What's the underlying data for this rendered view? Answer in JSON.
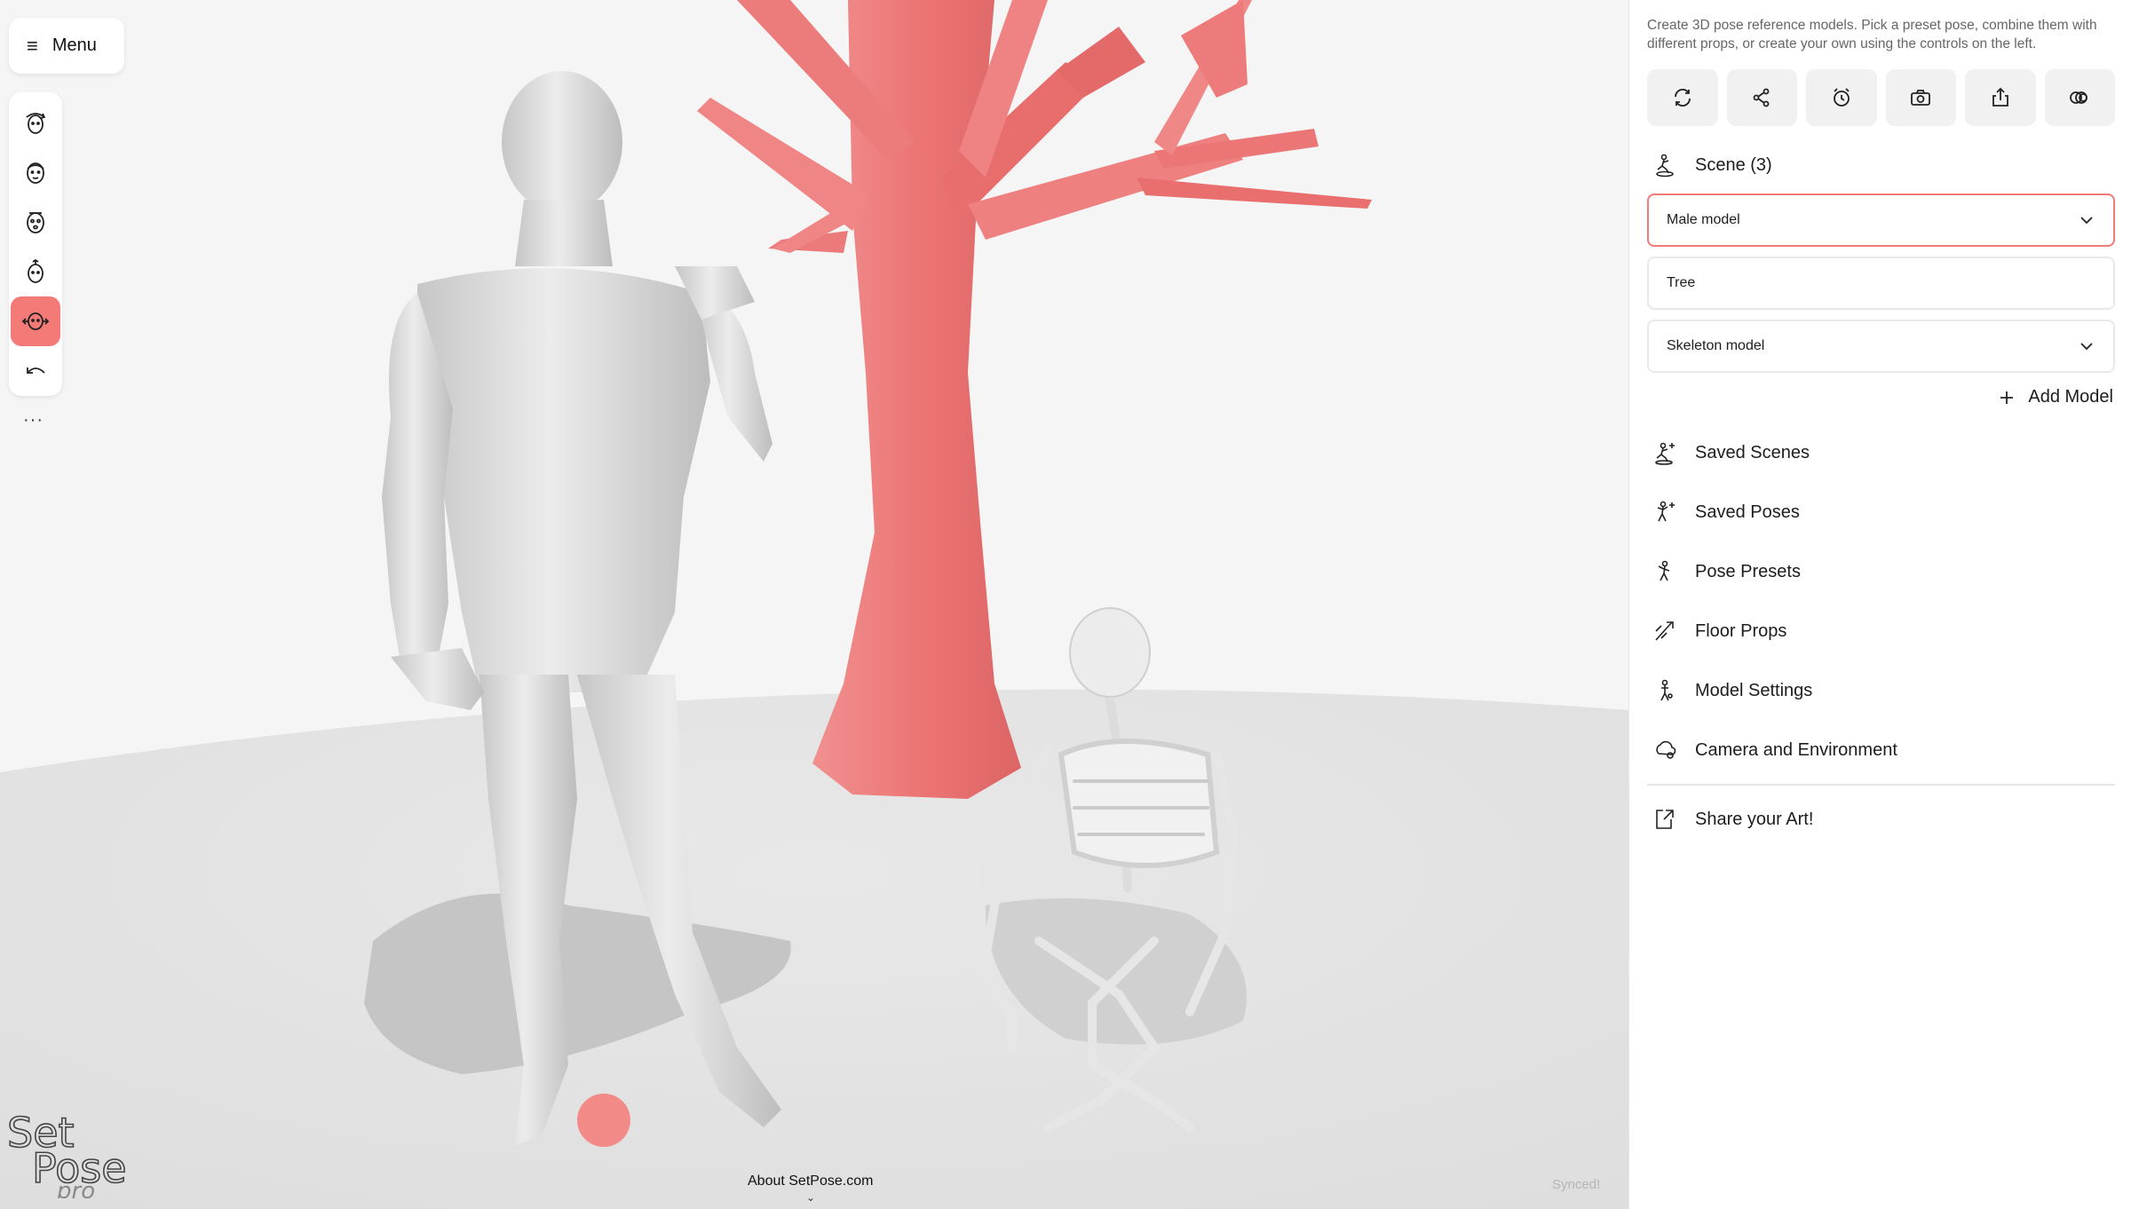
{
  "viewport": {
    "menu": {
      "icon": "hamburger-icon",
      "label": "Menu"
    },
    "toolbar": [
      {
        "name": "rotate-head-icon",
        "active": false
      },
      {
        "name": "face-front-icon",
        "active": false
      },
      {
        "name": "face-expression-icon",
        "active": false
      },
      {
        "name": "head-tilt-icon",
        "active": false
      },
      {
        "name": "move-joint-icon",
        "active": true
      },
      {
        "name": "undo-icon",
        "active": false
      }
    ],
    "more": "···",
    "logo": {
      "line1": "Set",
      "line2": "Pose",
      "line3": "pro"
    },
    "about": "About SetPose.com",
    "about_chevron": "⌄",
    "status": "Synced!"
  },
  "panel": {
    "intro": "Create 3D pose reference models. Pick a preset pose, combine them with different props, or create your own using the controls on the left.",
    "actions": [
      "refresh-icon",
      "share-nodes-icon",
      "timer-icon",
      "camera-icon",
      "export-icon",
      "gallery-icon"
    ],
    "scene_title": "Scene (3)",
    "models": [
      {
        "label": "Male model",
        "selected": true,
        "dropdown": true
      },
      {
        "label": "Tree",
        "selected": false,
        "dropdown": false
      },
      {
        "label": "Skeleton model",
        "selected": false,
        "dropdown": true
      }
    ],
    "add_model": "Add Model",
    "nav": [
      {
        "label": "Saved Scenes",
        "icon": "saved-scenes-icon"
      },
      {
        "label": "Saved Poses",
        "icon": "saved-poses-icon"
      },
      {
        "label": "Pose Presets",
        "icon": "pose-presets-icon"
      },
      {
        "label": "Floor Props",
        "icon": "floor-props-icon"
      },
      {
        "label": "Model Settings",
        "icon": "model-settings-icon"
      },
      {
        "label": "Camera and Environment",
        "icon": "camera-environment-icon"
      }
    ],
    "share": {
      "label": "Share your Art!",
      "icon": "share-art-icon"
    }
  },
  "colors": {
    "accent": "#f47a78",
    "tree": "#ee7a7a",
    "figure": "#d9d9d9",
    "ground": "#e9e9e9"
  }
}
